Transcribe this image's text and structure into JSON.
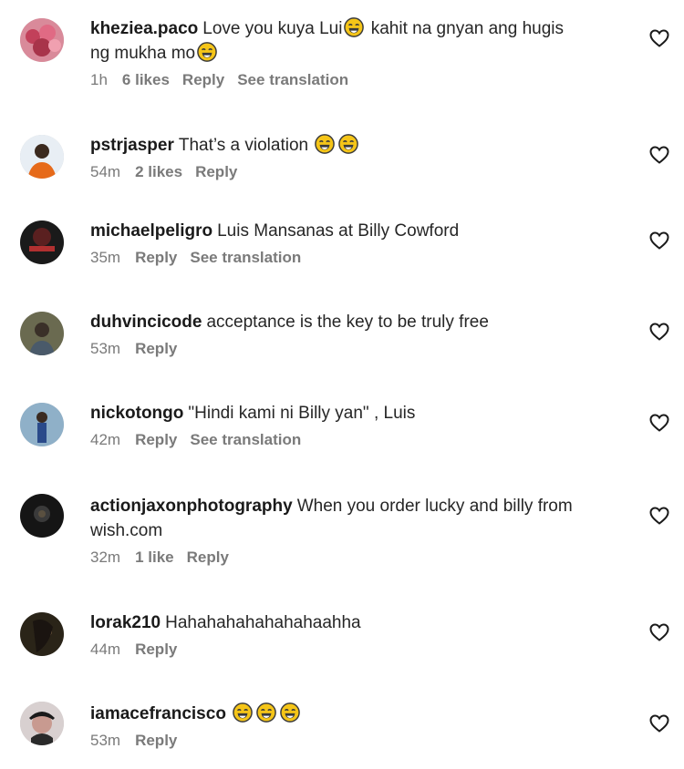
{
  "comments": [
    {
      "username": "kheziea.paco",
      "text_parts": [
        "Love you kuya Lui",
        "kahit na gnyan ang hugis",
        "ng mukha mo"
      ],
      "time": "1h",
      "likes": "6 likes",
      "reply": "Reply",
      "translate": "See translation",
      "avatar": "flowers"
    },
    {
      "username": "pstrjasper",
      "text": "That’s a violation",
      "time": "54m",
      "likes": "2 likes",
      "reply": "Reply",
      "avatar": "person-orange"
    },
    {
      "username": "michaelpeligro",
      "text": "Luis Mansanas at Billy Cowford",
      "time": "35m",
      "reply": "Reply",
      "translate": "See translation",
      "avatar": "dark-logo"
    },
    {
      "username": "duhvincicode",
      "text": "acceptance is the key to be truly free",
      "time": "53m",
      "reply": "Reply",
      "avatar": "outdoor"
    },
    {
      "username": "nickotongo",
      "text": "\"Hindi kami ni Billy yan\" , Luis",
      "time": "42m",
      "reply": "Reply",
      "translate": "See translation",
      "avatar": "standing-person"
    },
    {
      "username": "actionjaxonphotography",
      "text": "When you order lucky and billy from wish.com",
      "time": "32m",
      "likes": "1 like",
      "reply": "Reply",
      "avatar": "dark"
    },
    {
      "username": "lorak210",
      "text": "Hahahahahahahahaahha",
      "time": "44m",
      "reply": "Reply",
      "avatar": "woman"
    },
    {
      "username": "iamacefrancisco",
      "text": "",
      "time": "53m",
      "reply": "Reply",
      "avatar": "cap-person"
    }
  ],
  "icons": {
    "heart": "heart-outline-icon",
    "emoji": "laughing-tears-emoji"
  },
  "colors": {
    "meta": "#7a7a7a",
    "text": "#262626",
    "emoji": "#f5c518"
  }
}
